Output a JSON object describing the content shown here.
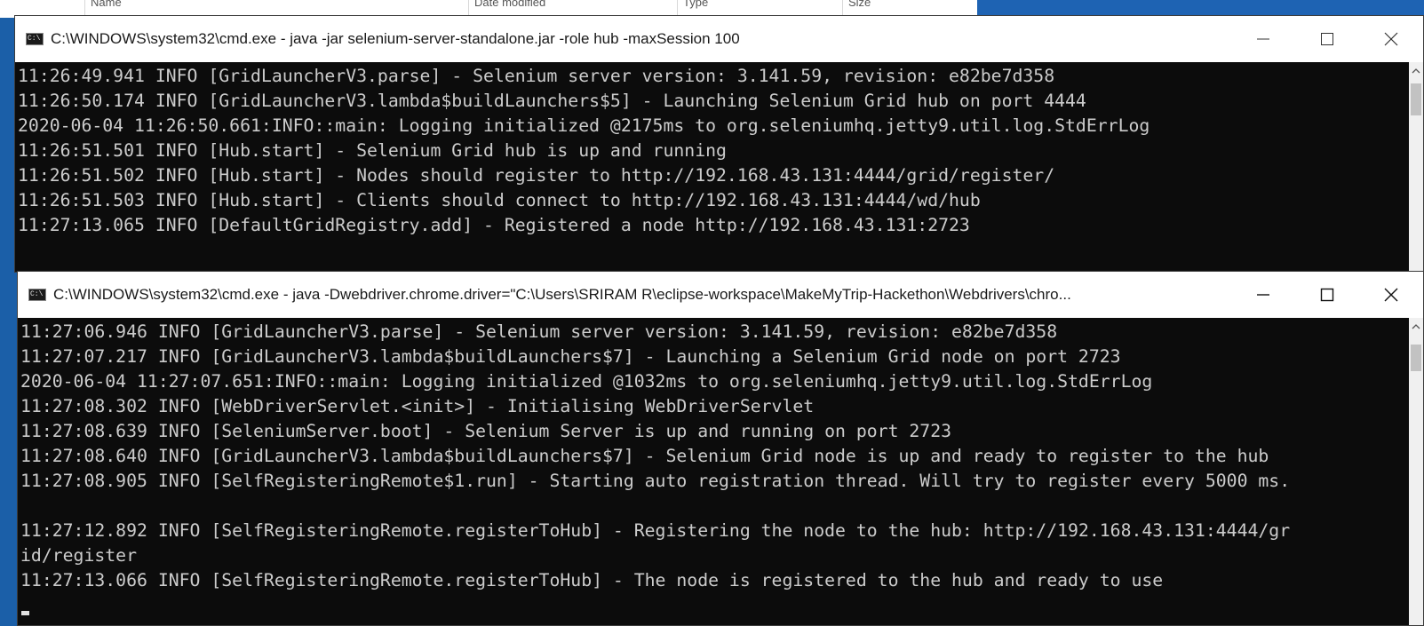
{
  "background_window": {
    "columns": [
      "Name",
      "Date modified",
      "Type",
      "Size"
    ]
  },
  "hub_window": {
    "title": "C:\\WINDOWS\\system32\\cmd.exe - java  -jar selenium-server-standalone.jar -role hub -maxSession 100",
    "icon_label": "C:\\",
    "lines": [
      "11:26:49.941 INFO [GridLauncherV3.parse] - Selenium server version: 3.141.59, revision: e82be7d358",
      "11:26:50.174 INFO [GridLauncherV3.lambda$buildLaunchers$5] - Launching Selenium Grid hub on port 4444",
      "2020-06-04 11:26:50.661:INFO::main: Logging initialized @2175ms to org.seleniumhq.jetty9.util.log.StdErrLog",
      "11:26:51.501 INFO [Hub.start] - Selenium Grid hub is up and running",
      "11:26:51.502 INFO [Hub.start] - Nodes should register to http://192.168.43.131:4444/grid/register/",
      "11:26:51.503 INFO [Hub.start] - Clients should connect to http://192.168.43.131:4444/wd/hub",
      "11:27:13.065 INFO [DefaultGridRegistry.add] - Registered a node http://192.168.43.131:2723"
    ]
  },
  "node_window": {
    "title": "C:\\WINDOWS\\system32\\cmd.exe - java  -Dwebdriver.chrome.driver=\"C:\\Users\\SRIRAM R\\eclipse-workspace\\MakeMyTrip-Hackethon\\Webdrivers\\chro...",
    "icon_label": "C:\\",
    "lines": [
      "11:27:06.946 INFO [GridLauncherV3.parse] - Selenium server version: 3.141.59, revision: e82be7d358",
      "11:27:07.217 INFO [GridLauncherV3.lambda$buildLaunchers$7] - Launching a Selenium Grid node on port 2723",
      "2020-06-04 11:27:07.651:INFO::main: Logging initialized @1032ms to org.seleniumhq.jetty9.util.log.StdErrLog",
      "11:27:08.302 INFO [WebDriverServlet.<init>] - Initialising WebDriverServlet",
      "11:27:08.639 INFO [SeleniumServer.boot] - Selenium Server is up and running on port 2723",
      "11:27:08.640 INFO [GridLauncherV3.lambda$buildLaunchers$7] - Selenium Grid node is up and ready to register to the hub",
      "11:27:08.905 INFO [SelfRegisteringRemote$1.run] - Starting auto registration thread. Will try to register every 5000 ms.",
      "",
      "11:27:12.892 INFO [SelfRegisteringRemote.registerToHub] - Registering the node to the hub: http://192.168.43.131:4444/gr",
      "id/register",
      "11:27:13.066 INFO [SelfRegisteringRemote.registerToHub] - The node is registered to the hub and ready to use"
    ]
  },
  "colors": {
    "desktop": "#1b5fa8",
    "console_bg": "#0c0c0c",
    "console_text": "#cccccc",
    "titlebar": "#ffffff"
  }
}
